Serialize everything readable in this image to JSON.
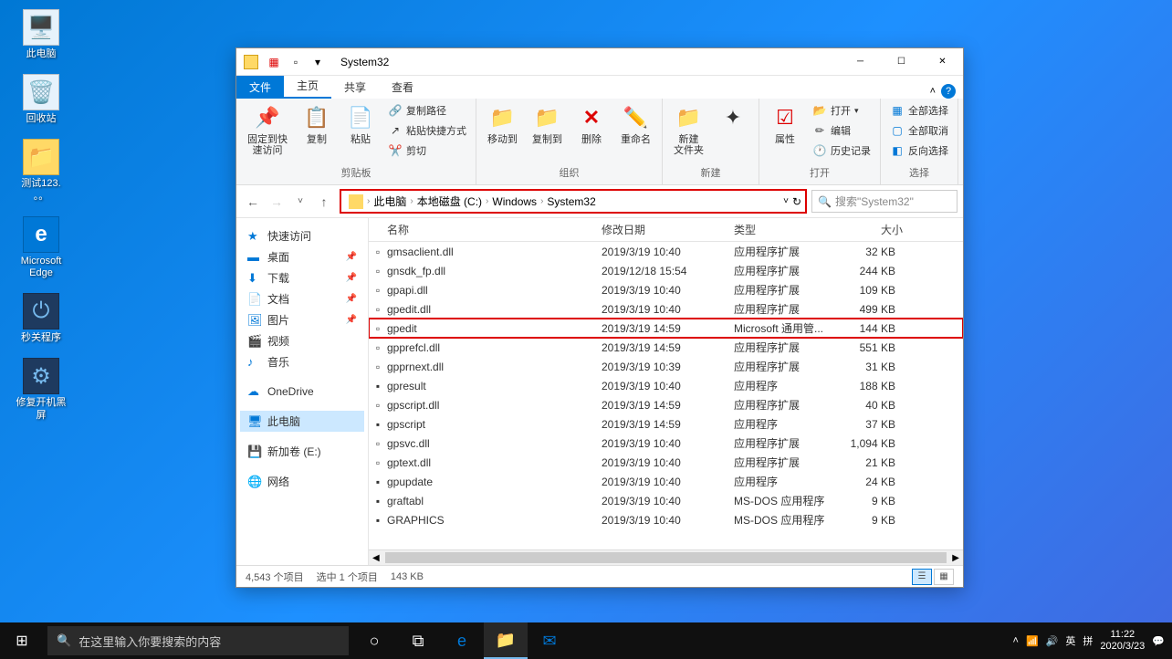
{
  "desktop": {
    "icons": [
      {
        "name": "this-pc",
        "label": "此电脑",
        "glyph": "🖥️"
      },
      {
        "name": "recycle-bin",
        "label": "回收站",
        "glyph": "🗑️"
      },
      {
        "name": "test-folder",
        "label": "测试123.\n。。",
        "glyph": "📁"
      },
      {
        "name": "edge",
        "label": "Microsoft\nEdge",
        "glyph": "e"
      },
      {
        "name": "shutdown-app",
        "label": "秒关程序",
        "glyph": "⏻"
      },
      {
        "name": "repair-app",
        "label": "修复开机黑\n屏",
        "glyph": "⚙️"
      }
    ]
  },
  "window": {
    "title": "System32",
    "tabs": {
      "file": "文件",
      "home": "主页",
      "share": "共享",
      "view": "查看"
    },
    "ribbon": {
      "pin": "固定到快\n速访问",
      "copy": "复制",
      "paste": "粘贴",
      "copy_path": "复制路径",
      "paste_shortcut": "粘贴快捷方式",
      "cut": "剪切",
      "clipboard_group": "剪贴板",
      "move_to": "移动到",
      "copy_to": "复制到",
      "delete": "删除",
      "rename": "重命名",
      "organize_group": "组织",
      "new_folder": "新建\n文件夹",
      "new_group": "新建",
      "properties": "属性",
      "open": "打开",
      "edit": "编辑",
      "history": "历史记录",
      "open_group": "打开",
      "select_all": "全部选择",
      "select_none": "全部取消",
      "invert_selection": "反向选择",
      "select_group": "选择"
    },
    "breadcrumbs": [
      "此电脑",
      "本地磁盘 (C:)",
      "Windows",
      "System32"
    ],
    "refresh": "↻",
    "search_placeholder": "搜索\"System32\"",
    "sidebar": {
      "quick_access": "快速访问",
      "desktop": "桌面",
      "downloads": "下载",
      "documents": "文档",
      "pictures": "图片",
      "videos": "视频",
      "music": "音乐",
      "onedrive": "OneDrive",
      "this_pc": "此电脑",
      "new_volume": "新加卷 (E:)",
      "network": "网络"
    },
    "columns": {
      "name": "名称",
      "date": "修改日期",
      "type": "类型",
      "size": "大小"
    },
    "files": [
      {
        "name": "gmsaclient.dll",
        "date": "2019/3/19 10:40",
        "type": "应用程序扩展",
        "size": "32 KB",
        "icon": "▫"
      },
      {
        "name": "gnsdk_fp.dll",
        "date": "2019/12/18 15:54",
        "type": "应用程序扩展",
        "size": "244 KB",
        "icon": "▫"
      },
      {
        "name": "gpapi.dll",
        "date": "2019/3/19 10:40",
        "type": "应用程序扩展",
        "size": "109 KB",
        "icon": "▫"
      },
      {
        "name": "gpedit.dll",
        "date": "2019/3/19 10:40",
        "type": "应用程序扩展",
        "size": "499 KB",
        "icon": "▫"
      },
      {
        "name": "gpedit",
        "date": "2019/3/19 14:59",
        "type": "Microsoft 通用管...",
        "size": "144 KB",
        "icon": "▫",
        "highlighted": true
      },
      {
        "name": "gpprefcl.dll",
        "date": "2019/3/19 14:59",
        "type": "应用程序扩展",
        "size": "551 KB",
        "icon": "▫"
      },
      {
        "name": "gpprnext.dll",
        "date": "2019/3/19 10:39",
        "type": "应用程序扩展",
        "size": "31 KB",
        "icon": "▫"
      },
      {
        "name": "gpresult",
        "date": "2019/3/19 10:40",
        "type": "应用程序",
        "size": "188 KB",
        "icon": "▪"
      },
      {
        "name": "gpscript.dll",
        "date": "2019/3/19 14:59",
        "type": "应用程序扩展",
        "size": "40 KB",
        "icon": "▫"
      },
      {
        "name": "gpscript",
        "date": "2019/3/19 14:59",
        "type": "应用程序",
        "size": "37 KB",
        "icon": "▪"
      },
      {
        "name": "gpsvc.dll",
        "date": "2019/3/19 10:40",
        "type": "应用程序扩展",
        "size": "1,094 KB",
        "icon": "▫"
      },
      {
        "name": "gptext.dll",
        "date": "2019/3/19 10:40",
        "type": "应用程序扩展",
        "size": "21 KB",
        "icon": "▫"
      },
      {
        "name": "gpupdate",
        "date": "2019/3/19 10:40",
        "type": "应用程序",
        "size": "24 KB",
        "icon": "▪"
      },
      {
        "name": "graftabl",
        "date": "2019/3/19 10:40",
        "type": "MS-DOS 应用程序",
        "size": "9 KB",
        "icon": "▪"
      },
      {
        "name": "GRAPHICS",
        "date": "2019/3/19 10:40",
        "type": "MS-DOS 应用程序",
        "size": "9 KB",
        "icon": "▪"
      }
    ],
    "status": {
      "items": "4,543 个项目",
      "selected": "选中 1 个项目",
      "size": "143 KB"
    }
  },
  "taskbar": {
    "search_placeholder": "在这里输入你要搜索的内容",
    "time": "11:22",
    "date": "2020/3/23",
    "ime": "英",
    "ime2": "拼"
  }
}
